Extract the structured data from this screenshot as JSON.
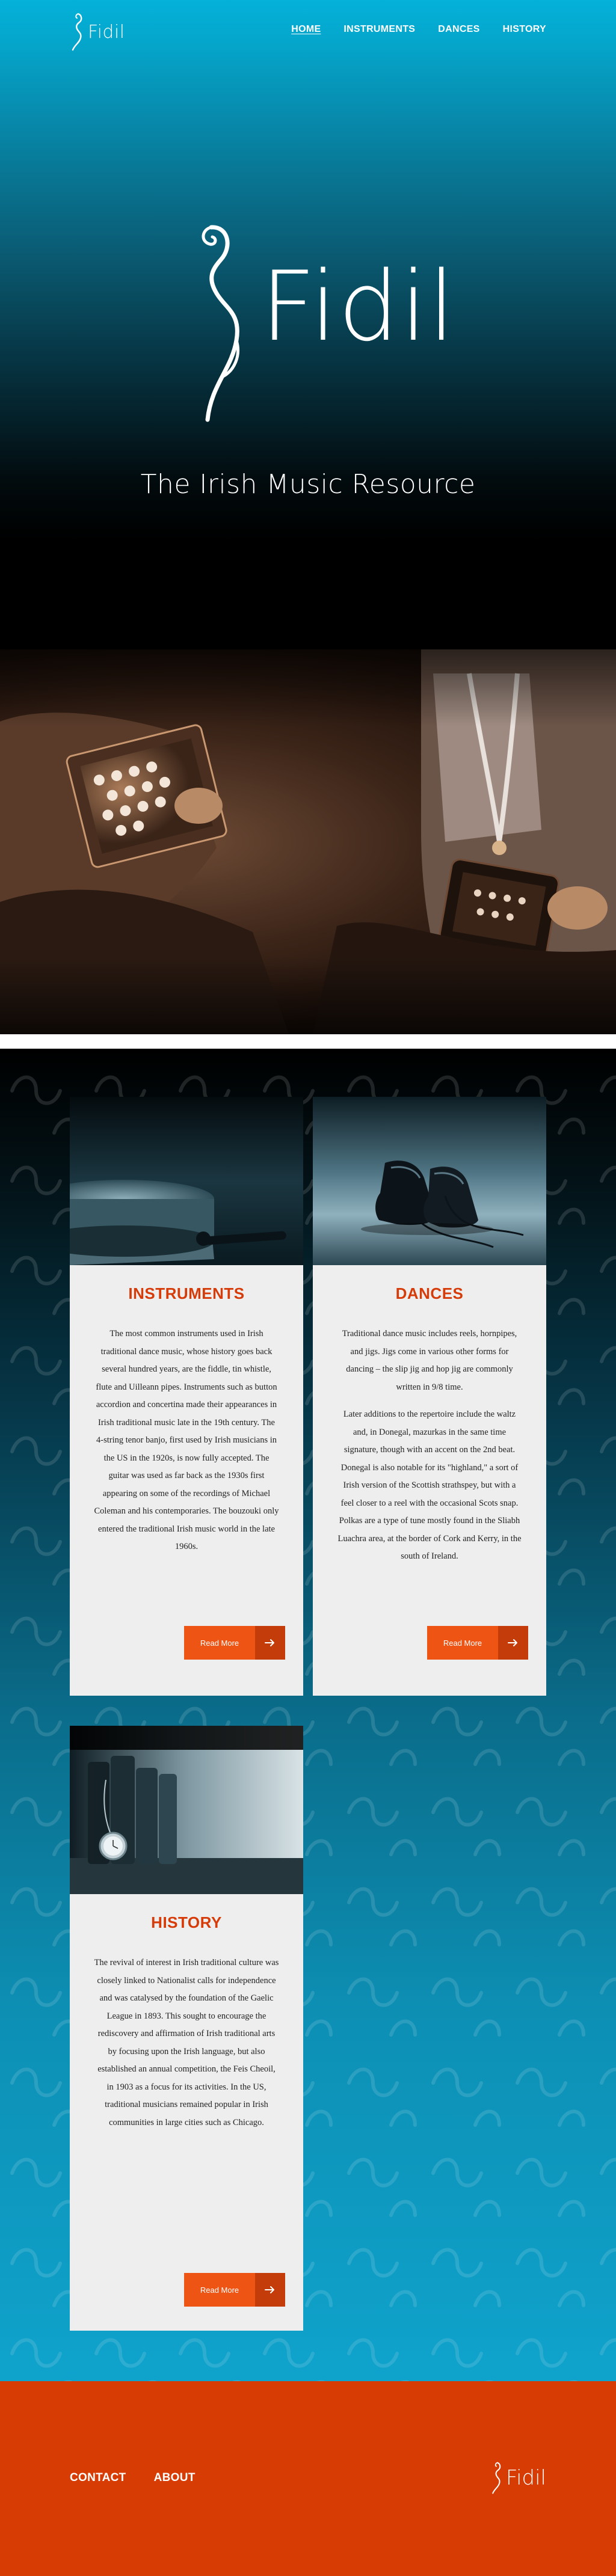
{
  "brand": {
    "name": "Fidil",
    "tagline": "The Irish Music Resource"
  },
  "nav": {
    "items": [
      {
        "label": "HOME",
        "active": true
      },
      {
        "label": "INSTRUMENTS",
        "active": false
      },
      {
        "label": "DANCES",
        "active": false
      },
      {
        "label": "HISTORY",
        "active": false
      }
    ]
  },
  "cards": [
    {
      "title": "INSTRUMENTS",
      "paragraphs": [
        "The most common instruments used in Irish traditional dance music, whose history goes back several hundred years, are the fiddle, tin whistle, flute and Uilleann pipes. Instruments such as button accordion and concertina made their appearances in Irish traditional music late in the 19th century. The 4-string tenor banjo, first used by Irish musicians in the US in the 1920s, is now fully accepted. The guitar was used as far back as the 1930s first appearing on some of the recordings of Michael Coleman and his contemporaries. The bouzouki only entered the traditional Irish music world in the late 1960s."
      ],
      "button": "Read More",
      "image_icon": "bodhran-photo"
    },
    {
      "title": "DANCES",
      "paragraphs": [
        "Traditional dance music includes reels, hornpipes, and jigs. Jigs come in various other forms for dancing – the slip jig and hop jig are commonly written in 9/8 time.",
        "Later additions to the repertoire include the waltz and, in Donegal, mazurkas in the same time signature, though with an accent on the 2nd beat. Donegal is also notable for its \"highland,\" a sort of Irish version of the Scottish strathspey, but with a feel closer to a reel with the occasional Scots snap. Polkas are a type  of  tune mostly found in the Sliabh Luachra area, at the border of Cork and Kerry, in the south of Ireland."
      ],
      "button": "Read More",
      "image_icon": "dance-shoes-photo"
    },
    {
      "title": "HISTORY",
      "paragraphs": [
        "The revival of interest in Irish traditional culture was closely linked to Nationalist calls for independence and was catalysed by the foundation of the Gaelic League in 1893. This sought to encourage the rediscovery and affirmation of Irish traditional arts by focusing upon the Irish language, but also established an annual competition, the Feis Cheoil, in 1903 as a focus for its activities. In the US, traditional musicians remained popular in Irish communities in large cities such as Chicago."
      ],
      "button": "Read More",
      "image_icon": "books-pocket-watch-photo"
    }
  ],
  "footer": {
    "links": [
      {
        "label": "CONTACT"
      },
      {
        "label": "ABOUT"
      }
    ],
    "logo": "Fidil"
  },
  "colors": {
    "accent": "#ee5515",
    "accent_dark": "#c53c0b",
    "heading": "#d63c0a",
    "footer": "#d63c03",
    "hero_top": "#04b1d9"
  },
  "icons": [
    "fiddle-scroll-icon",
    "arrow-right-icon"
  ]
}
